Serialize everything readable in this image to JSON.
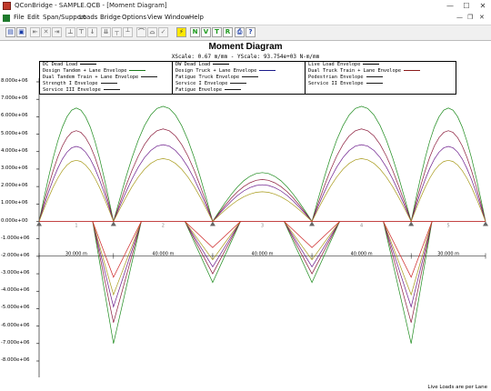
{
  "window": {
    "title": "QConBridge - SAMPLE.QCB - [Moment Diagram]",
    "app_icon": "qconbridge-app-icon",
    "controls": [
      "minimize-icon",
      "maximize-icon",
      "close-icon"
    ]
  },
  "menu": {
    "items": [
      "File",
      "Edit",
      "Span/Support",
      "Loads",
      "Bridge",
      "Options",
      "View",
      "Window",
      "Help"
    ]
  },
  "toolbar": {
    "buttons": [
      {
        "name": "open-file-icon",
        "glyph": "▤",
        "style": "b"
      },
      {
        "name": "save-file-icon",
        "glyph": "▣",
        "style": "b"
      },
      {
        "name": "insert-span-icon",
        "glyph": "⇤",
        "style": "grey"
      },
      {
        "name": "delete-span-icon",
        "glyph": "✕",
        "style": "grey"
      },
      {
        "name": "span-properties-icon",
        "glyph": "⇥",
        "style": "grey"
      },
      {
        "name": "support-left-icon",
        "glyph": "⊥",
        "style": "grey"
      },
      {
        "name": "support-right-icon",
        "glyph": "⊤",
        "style": "grey"
      },
      {
        "name": "point-load-icon",
        "glyph": "↓",
        "style": "grey"
      },
      {
        "name": "uniform-load-icon",
        "glyph": "⇊",
        "style": "grey"
      },
      {
        "name": "concentrated-load-icon",
        "glyph": "┬",
        "style": "grey"
      },
      {
        "name": "load-envelope-icon",
        "glyph": "┴",
        "style": "grey"
      },
      {
        "name": "moment-icon",
        "glyph": "⌒",
        "style": "grey"
      },
      {
        "name": "shear-icon",
        "glyph": "⌓",
        "style": "grey"
      },
      {
        "name": "check-icon",
        "glyph": "✓",
        "style": "grey"
      },
      {
        "name": "analyze-icon",
        "glyph": "⚡",
        "style": "y"
      },
      {
        "name": "n-diagram-icon",
        "glyph": "N",
        "style": "g"
      },
      {
        "name": "v-diagram-icon",
        "glyph": "V",
        "style": "g"
      },
      {
        "name": "t-diagram-icon",
        "glyph": "T",
        "style": "g"
      },
      {
        "name": "r-diagram-icon",
        "glyph": "R",
        "style": "g"
      },
      {
        "name": "print-icon",
        "glyph": "⎙",
        "style": "b"
      },
      {
        "name": "help-icon",
        "glyph": "?",
        "style": "b"
      }
    ]
  },
  "diagram": {
    "title": "Moment Diagram",
    "scale": "XScale: 0.67 m/mm - YScale: 93.754e+03 N-m/mm",
    "footnote": "Live Loads are per Lane",
    "y_axis": {
      "ticks": [
        {
          "value": 8000000,
          "label": "8.000e+06"
        },
        {
          "value": 7000000,
          "label": "7.000e+06"
        },
        {
          "value": 6000000,
          "label": "6.000e+06"
        },
        {
          "value": 5000000,
          "label": "5.000e+06"
        },
        {
          "value": 4000000,
          "label": "4.000e+06"
        },
        {
          "value": 3000000,
          "label": "3.000e+06"
        },
        {
          "value": 2000000,
          "label": "2.000e+06"
        },
        {
          "value": 1000000,
          "label": "1.000e+06"
        },
        {
          "value": 0,
          "label": "0.000e+00"
        },
        {
          "value": -1000000,
          "label": "-1.000e+06"
        },
        {
          "value": -2000000,
          "label": "-2.000e+06"
        },
        {
          "value": -3000000,
          "label": "-3.000e+06"
        },
        {
          "value": -4000000,
          "label": "-4.000e+06"
        },
        {
          "value": -5000000,
          "label": "-5.000e+06"
        },
        {
          "value": -6000000,
          "label": "-6.000e+06"
        },
        {
          "value": -7000000,
          "label": "-7.000e+06"
        },
        {
          "value": -8000000,
          "label": "-8.000e+06"
        }
      ]
    },
    "legend": [
      {
        "label": "DC Dead Load",
        "color": "#000000"
      },
      {
        "label": "DW Dead Load",
        "color": "#000000"
      },
      {
        "label": "Live Load Envelope",
        "color": "#000000"
      },
      {
        "label": "Design Tandem + Lane Envelope",
        "color": "#1a7a1a"
      },
      {
        "label": "Design Truck + Lane Envelope",
        "color": "#1a1a8a"
      },
      {
        "label": "Dual Truck Train + Lane Envelope",
        "color": "#8a1a1a"
      },
      {
        "label": "Dual Tandem Train + Lane Envelope",
        "color": "#1a1a1a"
      },
      {
        "label": "Fatigue Truck Envelope",
        "color": "#1a1a1a"
      },
      {
        "label": "Pedestrian Envelope",
        "color": "#1a1a1a"
      },
      {
        "label": "Strength I Envelope",
        "color": "#1a1a1a"
      },
      {
        "label": "Service I Envelope",
        "color": "#1a1a1a"
      },
      {
        "label": "Service II Envelope",
        "color": "#1a1a1a"
      },
      {
        "label": "Service III Envelope",
        "color": "#1a1a1a"
      },
      {
        "label": "Fatigue Envelope",
        "color": "#1a1a1a"
      }
    ],
    "spans": [
      {
        "label": "1",
        "length": "30.000 m"
      },
      {
        "label": "2",
        "length": "40.000 m"
      },
      {
        "label": "3",
        "length": "40.000 m"
      },
      {
        "label": "4",
        "length": "40.000 m"
      },
      {
        "label": "5",
        "length": "30.000 m"
      }
    ],
    "supports": [
      "1",
      "2",
      "3",
      "4",
      "5",
      "6"
    ]
  },
  "chart_data": {
    "type": "line",
    "title": "Moment Diagram",
    "ylabel": "",
    "xlabel": "",
    "ylim": [
      -8000000,
      8000000
    ],
    "x": [
      0,
      30,
      70,
      110,
      150,
      180
    ],
    "series": [
      {
        "name": "Strength I Envelope",
        "color": "#1b8a1b",
        "positive": [
          6500000,
          6600000,
          2800000,
          6600000,
          6500000
        ],
        "negative": [
          -7000000,
          -3500000,
          -3500000,
          -7000000
        ]
      },
      {
        "name": "Design Truck + Lane Envelope",
        "color": "#8a1a3a",
        "positive": [
          5200000,
          5300000,
          2400000,
          5300000,
          5200000
        ],
        "negative": [
          -5800000,
          -3000000,
          -3000000,
          -5800000
        ]
      },
      {
        "name": "Service I Envelope",
        "color": "#6a1a8a",
        "positive": [
          4300000,
          4400000,
          2100000,
          4400000,
          4300000
        ],
        "negative": [
          -4900000,
          -2600000,
          -2600000,
          -4900000
        ]
      },
      {
        "name": "Service III Envelope",
        "color": "#a89a1a",
        "positive": [
          3500000,
          3600000,
          1700000,
          3600000,
          3500000
        ],
        "negative": [
          -4200000,
          -2200000,
          -2200000,
          -4200000
        ]
      },
      {
        "name": "DC Dead Load",
        "color": "#cc2222",
        "positive": [
          0,
          0,
          0,
          0,
          0
        ],
        "negative": [
          -3200000,
          -1500000,
          -1500000,
          -3200000
        ]
      }
    ]
  }
}
